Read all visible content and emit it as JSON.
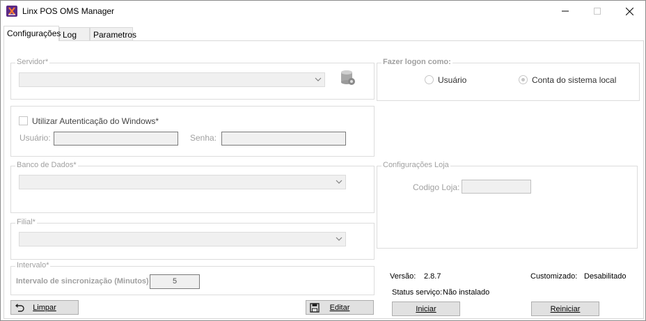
{
  "window": {
    "title": "Linx POS OMS Manager"
  },
  "tabs": [
    {
      "label": "Configurações",
      "active": true
    },
    {
      "label": "Log",
      "active": false
    },
    {
      "label": "Parametros",
      "active": false
    }
  ],
  "servidor": {
    "legend": "Servidor*",
    "value": "",
    "icon": "database-settings-icon"
  },
  "auth": {
    "checkbox_label": "Utilizar Autenticação do Windows*",
    "checked": false,
    "usuario_label": "Usuário:",
    "usuario_value": "",
    "senha_label": "Senha:",
    "senha_value": ""
  },
  "banco": {
    "legend": "Banco de Dados*",
    "value": ""
  },
  "filial": {
    "legend": "Filial*",
    "value": ""
  },
  "intervalo": {
    "legend": "Intervalo*",
    "label": "Intervalo de sincronização (Minutos)",
    "value": "5"
  },
  "logon": {
    "legend": "Fazer logon como:",
    "option_usuario": "Usuário",
    "option_conta": "Conta do sistema local",
    "selected": "Conta do sistema local"
  },
  "loja": {
    "legend": "Configurações Loja",
    "codigo_label": "Codigo Loja:",
    "codigo_value": ""
  },
  "info": {
    "versao_label": "Versão:",
    "versao_value": "2.8.7",
    "customizado_label": "Customizado:",
    "customizado_value": "Desabilitado",
    "status_label": "Status serviço:",
    "status_value": "Não instalado"
  },
  "buttons": {
    "limpar": "Limpar",
    "editar": "Editar",
    "iniciar": "Iniciar",
    "reiniciar": "Reiniciar"
  },
  "colors": {
    "app_icon": "#5b2a86",
    "disabled_text": "#a0a0a0",
    "button_face": "#e1e1e1"
  }
}
